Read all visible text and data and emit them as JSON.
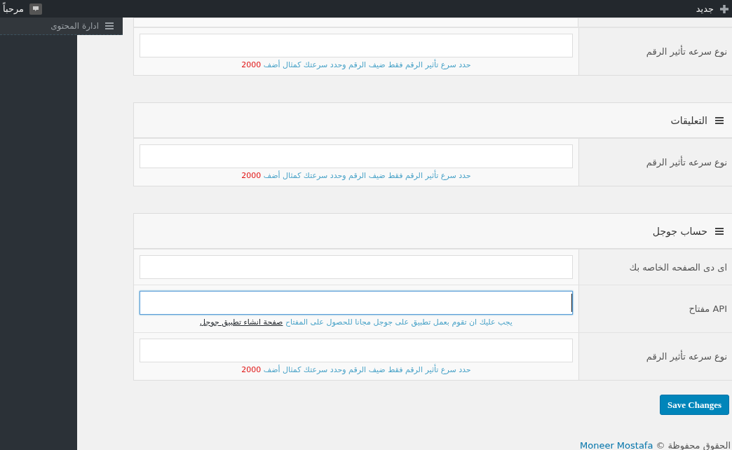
{
  "admin_bar": {
    "greeting": "مرحباً",
    "new_label": "جديد"
  },
  "sidebar": {
    "flyout_item": "ادارة المحتوى"
  },
  "partial_section": {
    "rows": [
      {
        "label": "نوع سرعه تأثير الرقم",
        "focused": false,
        "help": {
          "kind": "example",
          "text": "حدد سرع تأثير الرقم فقط ضيف الرقم وحدد سرعتك كمثال أضف",
          "value": "2000"
        }
      }
    ]
  },
  "sections": [
    {
      "title": "التعليقات",
      "rows": [
        {
          "label": "نوع سرعه تأثير الرقم",
          "focused": false,
          "help": {
            "kind": "example",
            "text": "حدد سرع تأثير الرقم فقط ضيف الرقم وحدد سرعتك كمثال أضف",
            "value": "2000"
          }
        }
      ]
    },
    {
      "title": "حساب جوجل",
      "rows": [
        {
          "label": "اى دى الصفحه الخاصه بك",
          "focused": false
        },
        {
          "label": "API مفتاح",
          "focused": true,
          "help": {
            "kind": "link",
            "text": "يجب عليك ان تقوم بعمل تطبيق على جوجل مجانا للحصول على المفتاح",
            "value": "صفحة انشاء تطبيق جوجل"
          }
        },
        {
          "label": "نوع سرعه تأثير الرقم",
          "focused": false,
          "help": {
            "kind": "example",
            "text": "حدد سرع تأثير الرقم فقط ضيف الرقم وحدد سرعتك كمثال أضف",
            "value": "2000"
          }
        }
      ]
    }
  ],
  "save_button": "Save Changes",
  "footer": {
    "text": "الحقوق محفوظة ©",
    "link": "Moneer Mostafa"
  }
}
